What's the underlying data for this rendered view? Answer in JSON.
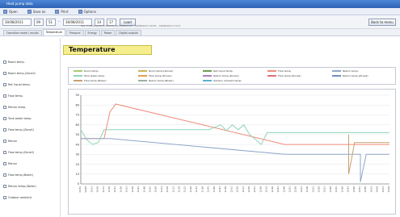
{
  "window": {
    "title": "Heat pump data"
  },
  "menu": [
    "Open",
    "Save as",
    "Print",
    "Options"
  ],
  "toolbar": {
    "from_date": "30/08/2011",
    "from_hour": "09",
    "from_min": "51",
    "to_date": "30/08/2011",
    "to_hour": "14",
    "to_min": "17",
    "load_label": "Load",
    "back_label": "Back to menu",
    "path_text": "File: P:\\HPLOG\\2011\\HPLOG_20110830.csv - 30/08/2011 09:51 - 30/08/2011 14:17"
  },
  "tabs": [
    {
      "label": "Operation mode / results",
      "active": false
    },
    {
      "label": "Temperature",
      "active": true
    },
    {
      "label": "Pressure",
      "active": false
    },
    {
      "label": "Energy",
      "active": false
    },
    {
      "label": "Power",
      "active": false
    },
    {
      "label": "Digital outputs",
      "active": false
    }
  ],
  "heading": "Temperature",
  "sidebar": [
    "Room temp.",
    "Room temp.(Zone2)",
    "Ref. liquid temp.",
    "Flow temp.",
    "Return temp.",
    "Tank water temp.",
    "Flow temp.(Zone1)",
    "Return",
    "Flow temp.(Zone2)",
    "Return",
    "Flow temp.(Boiler)",
    "Return temp.(Boiler)",
    "Outdoor ambient"
  ],
  "colors": {
    "flow": "#f08a78",
    "return": "#8fa6c8",
    "tank": "#8fd4b8",
    "room": "#a6cc6e",
    "boiler": "#c8a070"
  },
  "chart_data": {
    "type": "line",
    "title": "",
    "xlabel": "",
    "ylabel": "",
    "ylim": [
      0,
      90
    ],
    "yticks": [
      0,
      10,
      20,
      30,
      40,
      50,
      60,
      70,
      80,
      90
    ],
    "x": [
      "09:51",
      "09:56",
      "10:01",
      "10:06",
      "10:11",
      "10:16",
      "10:21",
      "10:26",
      "10:31",
      "10:36",
      "10:41",
      "10:46",
      "10:51",
      "10:56",
      "11:01",
      "11:06",
      "11:11",
      "11:16",
      "11:21",
      "11:26",
      "11:31",
      "11:36",
      "11:41",
      "11:46",
      "11:51",
      "11:56",
      "12:01",
      "12:06",
      "12:11",
      "12:16",
      "12:21",
      "12:26",
      "12:31",
      "12:36",
      "12:41",
      "12:46",
      "12:51",
      "12:56",
      "13:01",
      "13:06",
      "13:11",
      "13:16",
      "13:21",
      "13:26",
      "13:31",
      "13:36",
      "13:41",
      "13:46",
      "13:51",
      "13:56",
      "14:01",
      "14:06",
      "14:11",
      "14:16"
    ],
    "legend": [
      "Room temp.",
      "Room temp.(Zone2)",
      "Ref. liquid temp.",
      "Flow temp.",
      "Return temp.",
      "Tank water temp.",
      "Flow temp.(Zone1)",
      "Return temp.(Zone1)",
      "Flow temp.(Zone2)",
      "Return temp.(Zone2)",
      "Flow temp.(Boiler)",
      "Return temp.(Boiler)",
      "Outdoor ambient temp."
    ],
    "series": [
      {
        "name": "Flow temp.",
        "color": "#f08a78",
        "points": [
          [
            0,
            46
          ],
          [
            4,
            46
          ],
          [
            5,
            73
          ],
          [
            6,
            81
          ],
          [
            35,
            40
          ],
          [
            53,
            40
          ]
        ]
      },
      {
        "name": "Return temp.",
        "color": "#8fa6c8",
        "points": [
          [
            0,
            46
          ],
          [
            4,
            46
          ],
          [
            5,
            46
          ],
          [
            35,
            30
          ],
          [
            48,
            30
          ],
          [
            48,
            2
          ],
          [
            49,
            30
          ],
          [
            53,
            30
          ]
        ]
      },
      {
        "name": "Tank water temp.",
        "color": "#8fd4b8",
        "points": [
          [
            0,
            55
          ],
          [
            1,
            45
          ],
          [
            2,
            40
          ],
          [
            3,
            42
          ],
          [
            4,
            55
          ],
          [
            22,
            55
          ],
          [
            24,
            60
          ],
          [
            25,
            54
          ],
          [
            26,
            60
          ],
          [
            27,
            55
          ],
          [
            28,
            60
          ],
          [
            29,
            50
          ],
          [
            30,
            45
          ],
          [
            31,
            40
          ],
          [
            32,
            52
          ],
          [
            53,
            52
          ]
        ]
      },
      {
        "name": "Flow temp.(Boiler)",
        "color": "#c8a070",
        "points": [
          [
            46,
            50
          ],
          [
            46,
            10
          ],
          [
            47,
            42
          ],
          [
            53,
            42
          ]
        ]
      }
    ]
  }
}
